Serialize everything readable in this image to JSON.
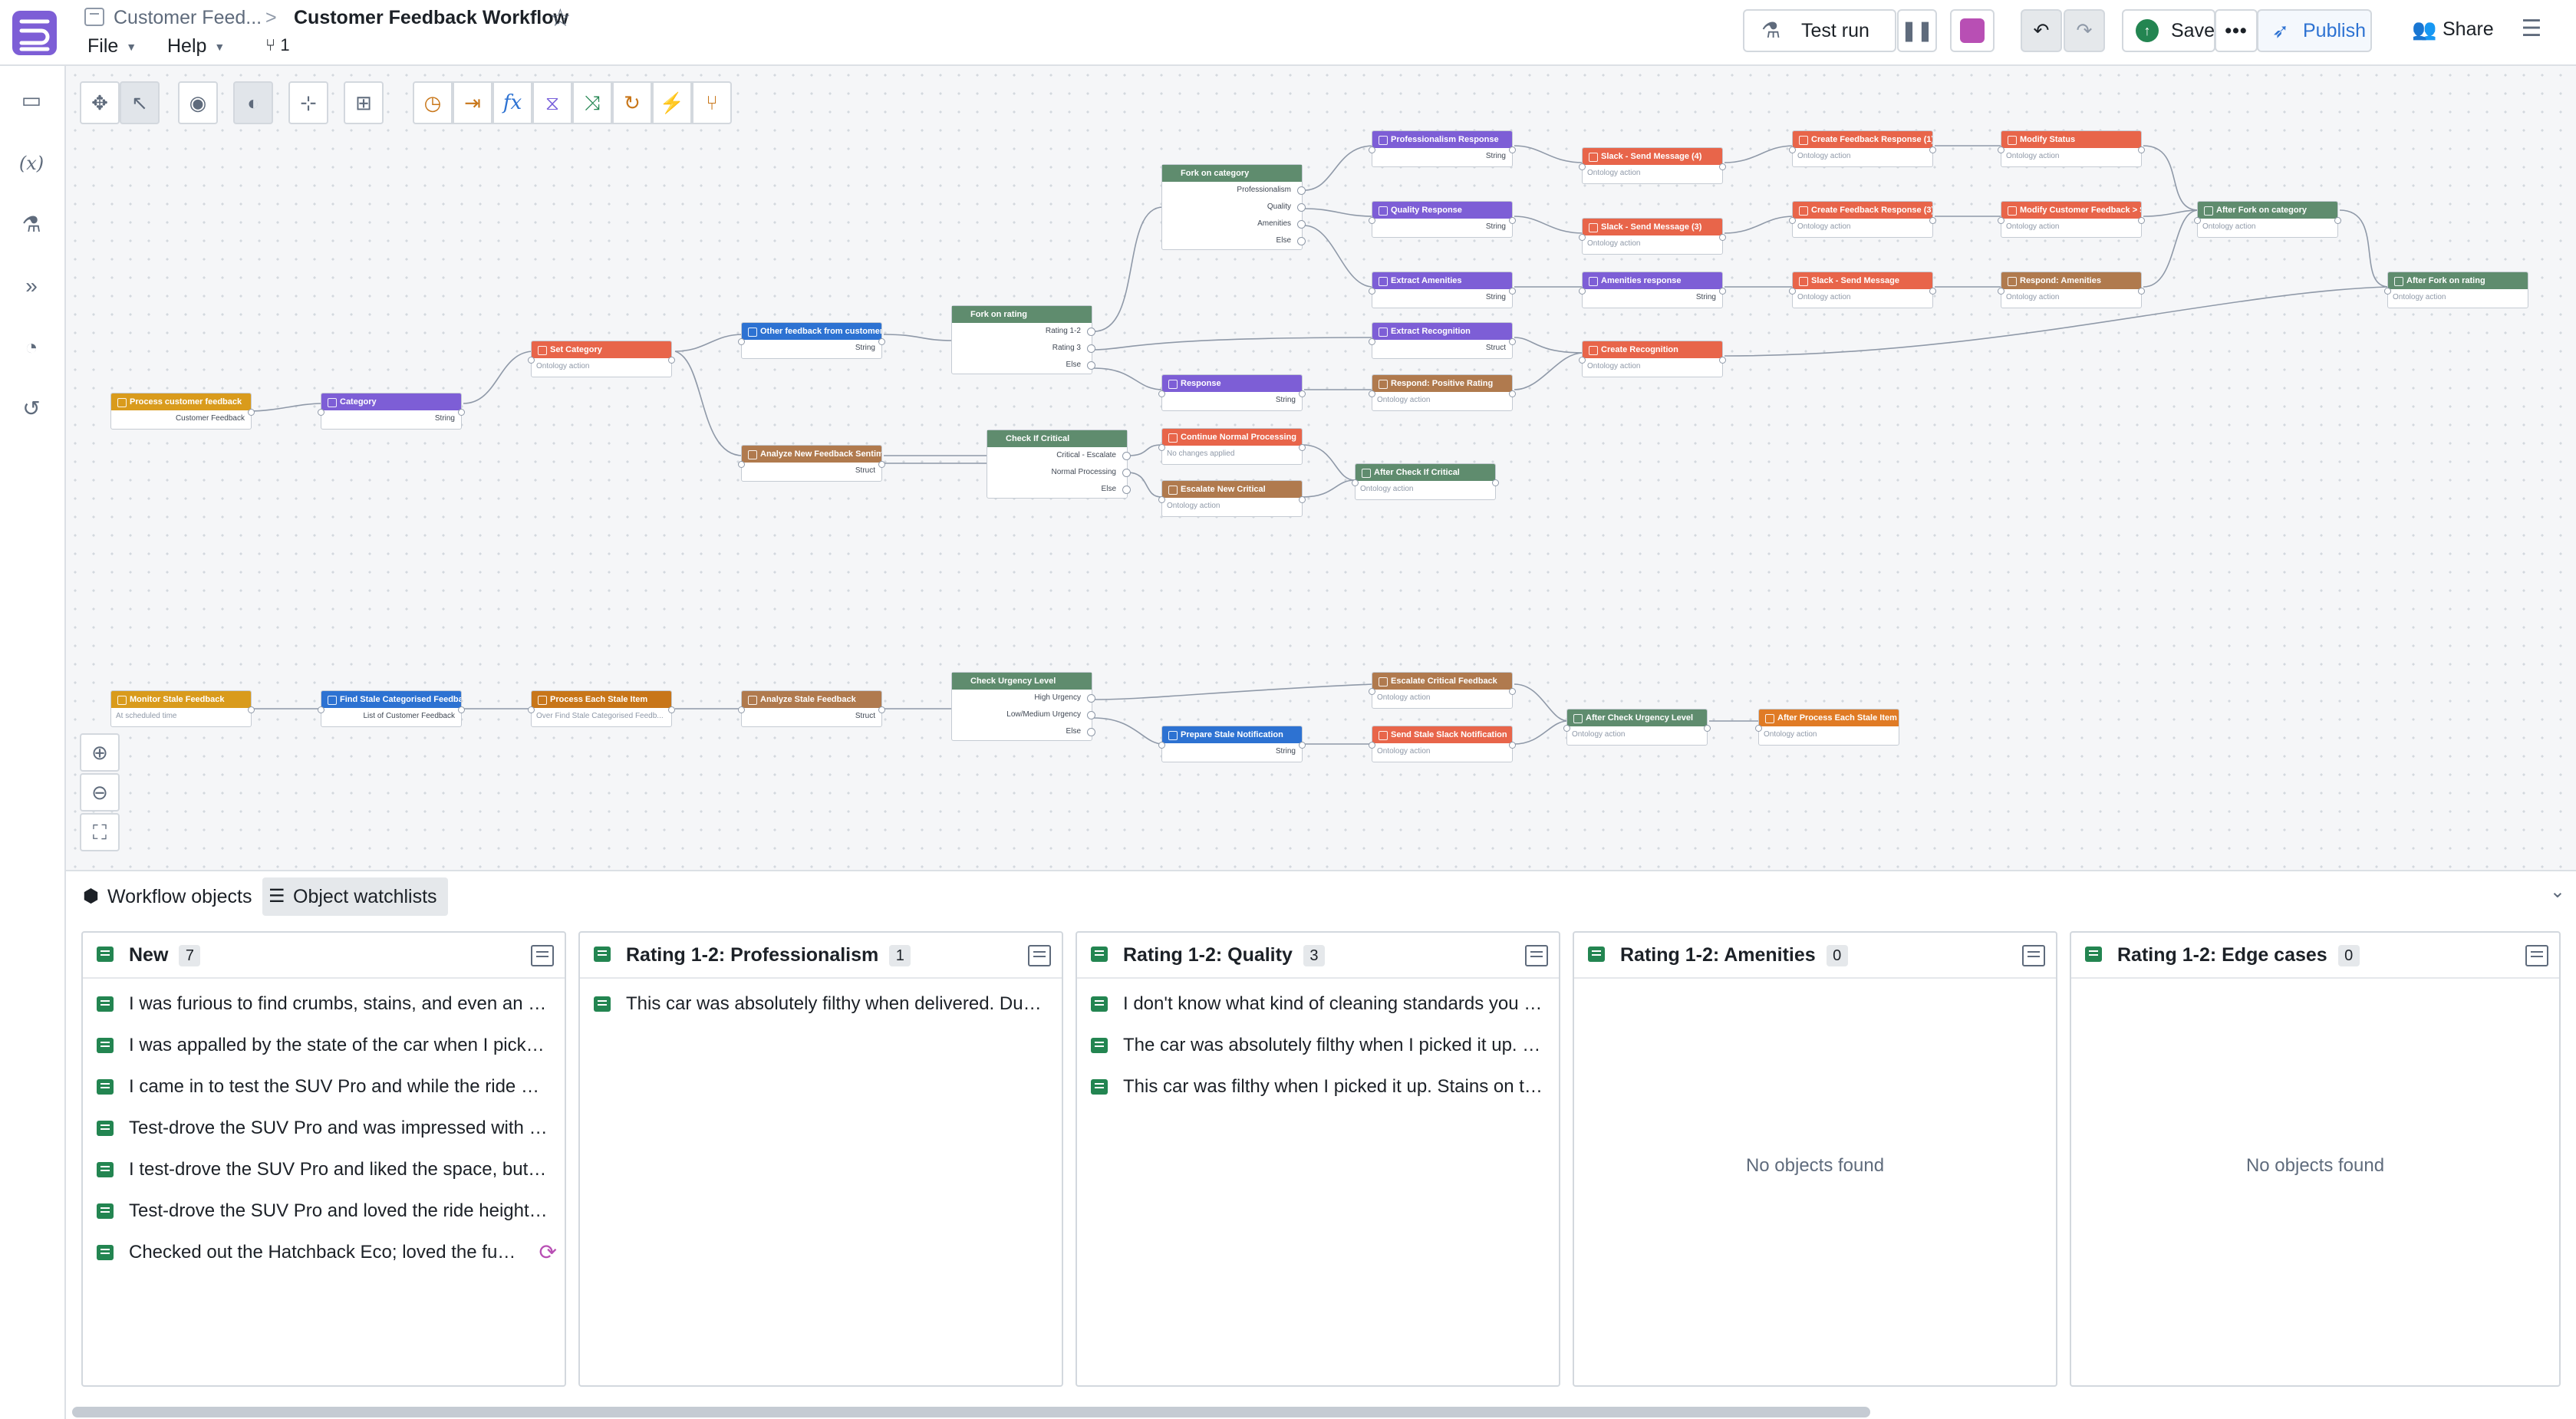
{
  "header": {
    "breadcrumb_parent": "Customer Feed...",
    "breadcrumb_separator": ">",
    "title": "Customer Feedback Workflow",
    "menus": [
      "File",
      "Help"
    ],
    "branch_count": "1",
    "test_run_label": "Test run",
    "save_label": "Save",
    "publish_label": "Publish",
    "share_label": "Share"
  },
  "colors": {
    "logic": "#5f8c6e",
    "action": "#e8654a",
    "function": "#2d72d2",
    "llm": "#7d5ed6",
    "trigger": "#d99b1c",
    "transform": "#b07a4e",
    "panel_accent": "#238551"
  },
  "workflow": {
    "nodes": {
      "process_customer_feedback": {
        "title": "Process customer feedback",
        "sub": "Customer Feedback"
      },
      "category": {
        "title": "Category",
        "sub": "String"
      },
      "set_category": {
        "title": "Set Category",
        "sub": "Ontology action"
      },
      "other_feedback": {
        "title": "Other feedback from customer",
        "sub": "String"
      },
      "analyze_new_feedback": {
        "title": "Analyze New Feedback Sentim...",
        "sub": "Struct"
      },
      "fork_on_rating": {
        "title": "Fork on rating",
        "rows": [
          "Rating 1-2",
          "Rating 3",
          "Else"
        ]
      },
      "check_if_critical": {
        "title": "Check If Critical",
        "rows": [
          "Critical - Escalate",
          "Normal Processing",
          "Else"
        ]
      },
      "fork_on_category": {
        "title": "Fork on category",
        "rows": [
          "Professionalism",
          "Quality",
          "Amenities",
          "Else"
        ]
      },
      "continue_normal": {
        "title": "Continue Normal Processing",
        "sub": "No changes applied"
      },
      "escalate_new_critical": {
        "title": "Escalate New Critical",
        "sub": "Ontology action"
      },
      "response": {
        "title": "Response",
        "sub": "String"
      },
      "professionalism_response": {
        "title": "Professionalism Response",
        "sub": "String"
      },
      "quality_response": {
        "title": "Quality Response",
        "sub": "String"
      },
      "extract_amenities": {
        "title": "Extract Amenities",
        "sub": "String"
      },
      "extract_recognition": {
        "title": "Extract Recognition",
        "sub": "Struct"
      },
      "respond_positive_rating": {
        "title": "Respond: Positive Rating",
        "sub": "Ontology action"
      },
      "after_check_if_critical": {
        "title": "After Check If Critical",
        "sub": "Ontology action"
      },
      "slack_send_4": {
        "title": "Slack - Send Message (4)",
        "sub": "Ontology action"
      },
      "slack_send_3": {
        "title": "Slack - Send Message (3)",
        "sub": "Ontology action"
      },
      "amenities_response": {
        "title": "Amenities response",
        "sub": "String"
      },
      "create_recognition": {
        "title": "Create Recognition",
        "sub": "Ontology action"
      },
      "create_feedback_response_1": {
        "title": "Create Feedback Response (1)",
        "sub": "Ontology action"
      },
      "create_feedback_response_3": {
        "title": "Create Feedback Response (3)",
        "sub": "Ontology action"
      },
      "slack_send": {
        "title": "Slack - Send Message",
        "sub": "Ontology action"
      },
      "modify_status": {
        "title": "Modify Status",
        "sub": "Ontology action"
      },
      "modify_customer_feedback": {
        "title": "Modify Customer Feedback > S...",
        "sub": "Ontology action"
      },
      "respond_amenities": {
        "title": "Respond: Amenities",
        "sub": "Ontology action"
      },
      "after_fork_on_category": {
        "title": "After Fork on category",
        "sub": "Ontology action"
      },
      "after_fork_on_rating": {
        "title": "After Fork on rating",
        "sub": "Ontology action"
      },
      "monitor_stale_feedback": {
        "title": "Monitor Stale Feedback",
        "sub": "At scheduled time"
      },
      "find_stale_categorised": {
        "title": "Find Stale Categorised Feedba...",
        "sub": "List of  Customer Feedback"
      },
      "process_each_stale_item": {
        "title": "Process Each Stale Item",
        "sub": "Over Find Stale Categorised Feedb..."
      },
      "analyze_stale_feedback": {
        "title": "Analyze Stale Feedback",
        "sub": "Struct"
      },
      "check_urgency_level": {
        "title": "Check Urgency Level",
        "rows": [
          "High Urgency",
          "Low/Medium Urgency",
          "Else"
        ]
      },
      "escalate_critical_feedback": {
        "title": "Escalate Critical Feedback",
        "sub": "Ontology action"
      },
      "prepare_stale_notification": {
        "title": "Prepare Stale Notification",
        "sub": "String"
      },
      "send_stale_slack": {
        "title": "Send Stale Slack Notification",
        "sub": "Ontology action"
      },
      "after_check_urgency": {
        "title": "After Check Urgency Level",
        "sub": "Ontology action"
      },
      "after_process_each": {
        "title": "After Process Each Stale Item",
        "sub": "Ontology action"
      }
    }
  },
  "panel": {
    "tabs": [
      "Workflow objects",
      "Object watchlists"
    ],
    "columns": [
      {
        "title": "New",
        "count": "7",
        "items": [
          "I was furious to find crumbs, stains, and even an old receipt in the car",
          "I was appalled by the state of the car when I picked it up",
          "I came in to test the SUV Pro and while the ride quality was great",
          "Test-drove the SUV Pro and was impressed with the handling",
          "I test-drove the SUV Pro and liked the space, but the infotainment lagged",
          "Test-drove the SUV Pro and loved the ride height and visibility",
          "Checked out the Hatchback Eco; loved the fuel economy"
        ],
        "empty": ""
      },
      {
        "title": "Rating 1-2: Professionalism",
        "count": "1",
        "items": [
          "This car was absolutely filthy when delivered. Dust everywhere"
        ],
        "empty": ""
      },
      {
        "title": "Rating 1-2: Quality",
        "count": "3",
        "items": [
          "I don't know what kind of cleaning standards you have",
          "The car was absolutely filthy when I picked it up. Dirt everywhere",
          "This car was filthy when I picked it up. Stains on the seats"
        ],
        "empty": ""
      },
      {
        "title": "Rating 1-2: Amenities",
        "count": "0",
        "items": [],
        "empty": "No objects found"
      },
      {
        "title": "Rating 1-2: Edge cases",
        "count": "0",
        "items": [],
        "empty": "No objects found"
      }
    ]
  }
}
